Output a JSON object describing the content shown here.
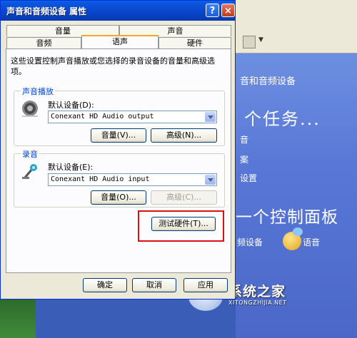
{
  "dialog": {
    "title": "声音和音频设备 属性",
    "help_label": "?",
    "close_label": "×",
    "tabs_row1": [
      "音量",
      "声音"
    ],
    "tabs_row2": [
      "音频",
      "语声",
      "硬件"
    ],
    "active_tab": "语声",
    "description": "这些设置控制声音播放或您选择的录音设备的音量和高级选项。",
    "playback": {
      "group_label": "声音播放",
      "default_label": "默认设备(D):",
      "device_value": "Conexant HD Audio output",
      "volume_button": "音量(V)...",
      "advanced_button": "高级(N)..."
    },
    "recording": {
      "group_label": "录音",
      "default_label": "默认设备(E):",
      "device_value": "Conexant HD Audio input",
      "volume_button": "音量(O)...",
      "advanced_button": "高级(C)..."
    },
    "test_hardware_button": "测试硬件(T)...",
    "ok_button": "确定",
    "cancel_button": "取消",
    "apply_button": "应用"
  },
  "background": {
    "category_title": "音和音频设备",
    "task_heading": "个任务...",
    "task_items": [
      "音",
      "案",
      "设置"
    ],
    "cp_heading": "一个控制面板",
    "cp_items": [
      "频设备",
      "语音"
    ]
  },
  "watermark": {
    "title": "系统之家",
    "url": "XITONGZHIJIA.NET"
  },
  "colors": {
    "titlebar": "#0842c4",
    "highlight_box": "#dd1111",
    "panel_blue": "#5877d6"
  }
}
